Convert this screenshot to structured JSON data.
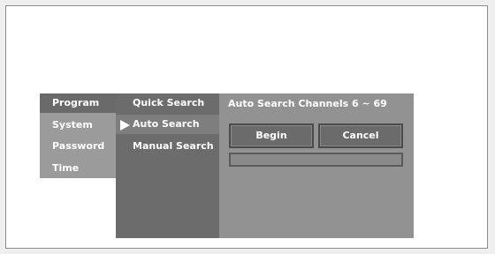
{
  "main_menu": {
    "items": [
      {
        "label": "Program",
        "active": true
      },
      {
        "label": "System",
        "active": false
      },
      {
        "label": "Password",
        "active": false
      },
      {
        "label": "Time",
        "active": false
      }
    ]
  },
  "sub_menu": {
    "items": [
      {
        "label": "Quick Search",
        "selected": false
      },
      {
        "label": "Auto Search",
        "selected": true
      },
      {
        "label": "Manual Search",
        "selected": false
      }
    ]
  },
  "panel": {
    "title": "Auto Search Channels 6 ~ 69",
    "begin_label": "Begin",
    "cancel_label": "Cancel",
    "progress": 0
  },
  "colors": {
    "page_bg": "#ffffff",
    "menu_bg": "#9b9b9b",
    "menu_active_bg": "#6a6a6a",
    "submenu_bg": "#6c6c6c",
    "panel_bg": "#929292",
    "text": "#ffffff"
  },
  "icons": {
    "selection_pointer": "triangle-right-icon"
  }
}
